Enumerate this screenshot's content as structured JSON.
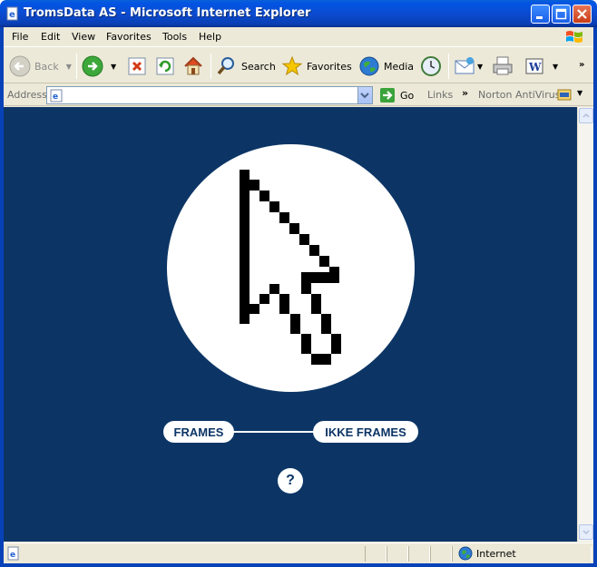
{
  "window": {
    "title": "TromsData AS - Microsoft Internet Explorer"
  },
  "menu": [
    "File",
    "Edit",
    "View",
    "Favorites",
    "Tools",
    "Help"
  ],
  "toolbar": {
    "back": "Back",
    "search": "Search",
    "favorites": "Favorites",
    "media": "Media"
  },
  "address": {
    "label": "Address",
    "value": "",
    "go": "Go",
    "links": "Links",
    "norton": "Norton AntiVirus"
  },
  "page": {
    "frames": "FRAMES",
    "ikke_frames": "IKKE FRAMES",
    "help": "?",
    "background": "#0c3566"
  },
  "status": {
    "zone": "Internet",
    "text": ""
  },
  "icons": [
    "ie-page-icon",
    "windows-logo-icon",
    "back-arrow-icon",
    "forward-arrow-icon",
    "stop-icon",
    "refresh-icon",
    "home-icon",
    "search-icon",
    "favorites-star-icon",
    "media-icon",
    "history-icon",
    "mail-icon",
    "print-icon",
    "word-icon",
    "go-arrow-icon",
    "internet-globe-icon",
    "pixel-cursor-icon"
  ]
}
